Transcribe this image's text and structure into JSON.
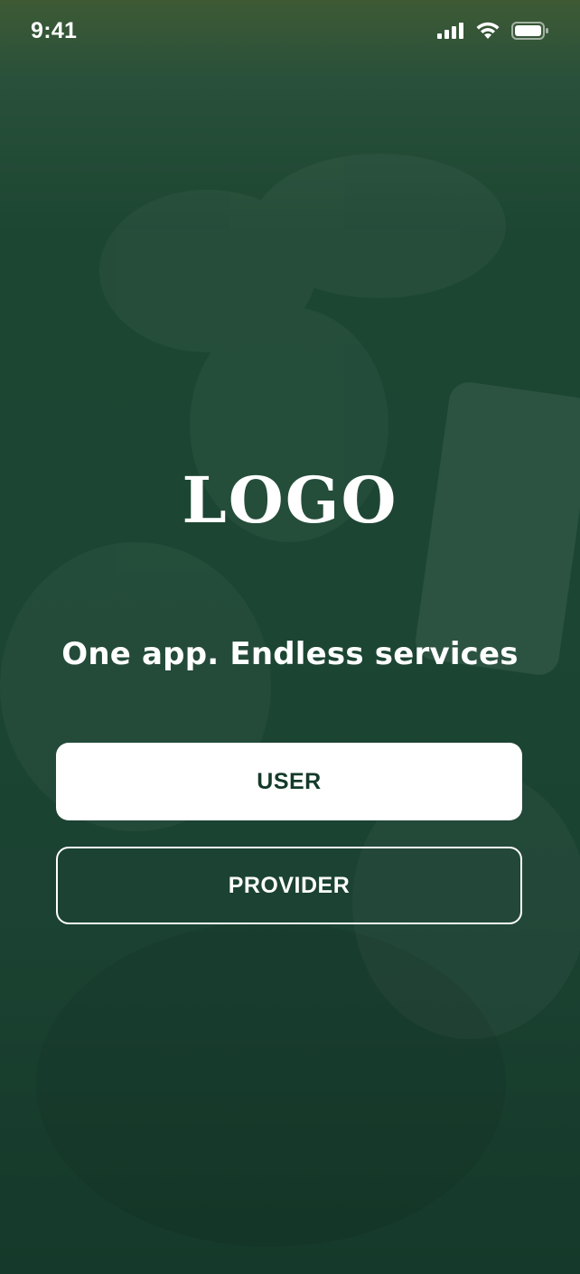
{
  "status_bar": {
    "time": "9:41",
    "icons": [
      "cellular-signal-icon",
      "wifi-icon",
      "battery-icon"
    ]
  },
  "logo": {
    "text": "LOGO"
  },
  "tagline": "One app. Endless services",
  "buttons": {
    "user_label": "USER",
    "provider_label": "PROVIDER"
  },
  "colors": {
    "background": "#1c4633",
    "primary_dark": "#143a2a",
    "button_light": "#ffffff",
    "text": "#ffffff"
  }
}
